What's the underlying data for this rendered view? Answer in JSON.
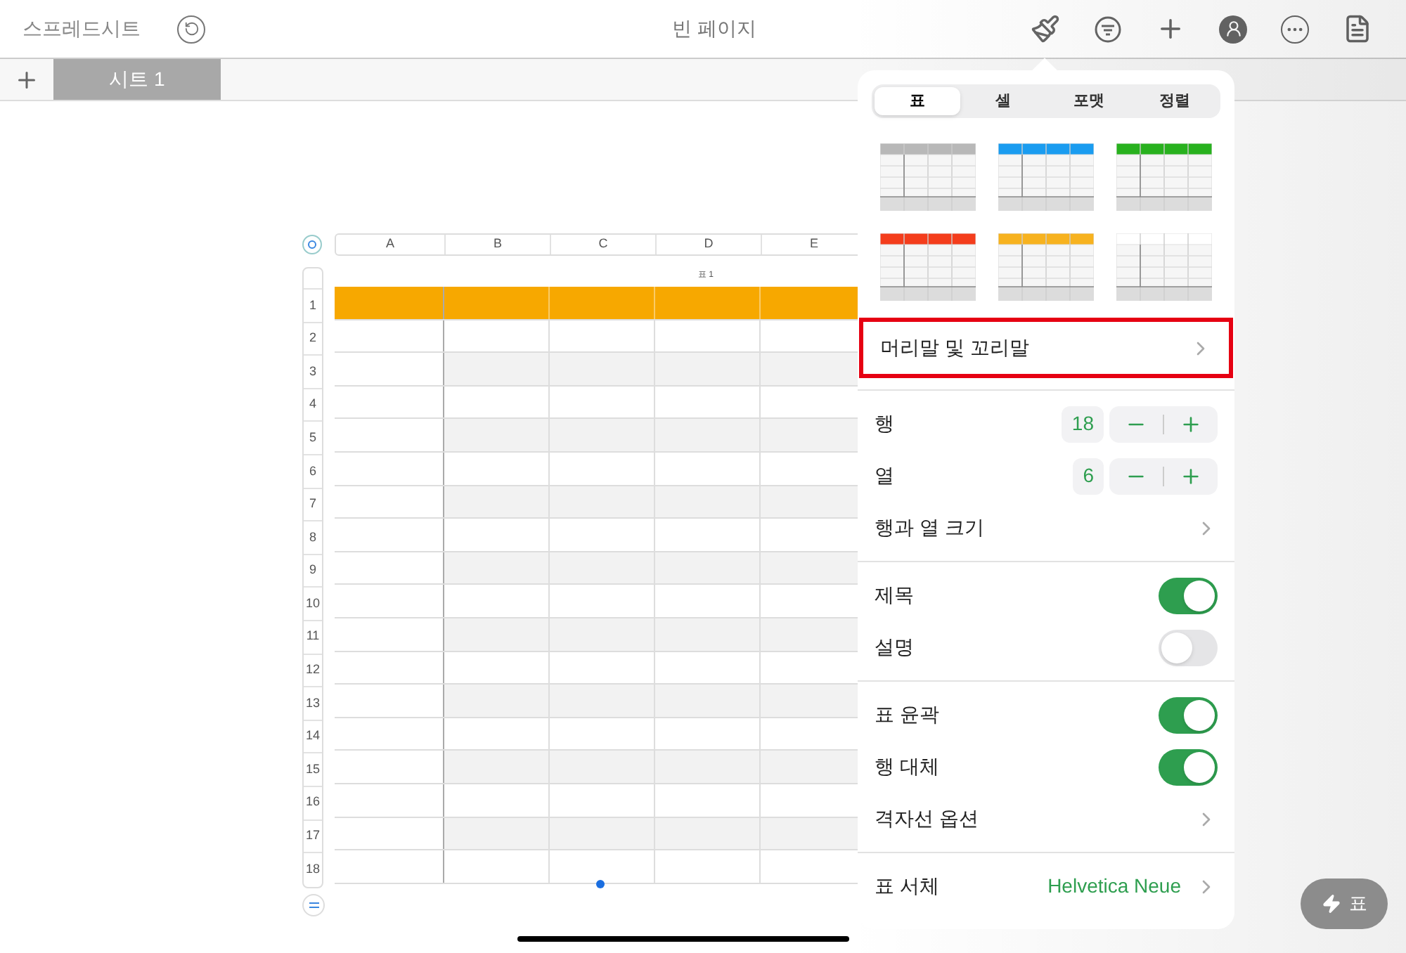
{
  "toolbar": {
    "back_label": "스프레드시트",
    "title": "빈 페이지"
  },
  "sheet_tabs": [
    {
      "label": "시트 1",
      "selected": true
    }
  ],
  "table": {
    "title": "표 1",
    "columns": [
      "A",
      "B",
      "C",
      "D",
      "E"
    ],
    "rows": [
      "1",
      "2",
      "3",
      "4",
      "5",
      "6",
      "7",
      "8",
      "9",
      "10",
      "11",
      "12",
      "13",
      "14",
      "15",
      "16",
      "17",
      "18"
    ]
  },
  "popover": {
    "tabs": [
      {
        "label": "표",
        "selected": true
      },
      {
        "label": "셀",
        "selected": false
      },
      {
        "label": "포맷",
        "selected": false
      },
      {
        "label": "정렬",
        "selected": false
      }
    ],
    "styles": [
      {
        "color": "#b8b8b8"
      },
      {
        "color": "#1a9cf0"
      },
      {
        "color": "#28b11e"
      },
      {
        "color": "#f43d1c"
      },
      {
        "color": "#f7b21f"
      },
      {
        "color": "#ffffff"
      }
    ],
    "sections": [
      [
        {
          "kind": "link",
          "label": "머리말 및 꼬리말",
          "highlighted": true
        }
      ],
      [
        {
          "kind": "stepper",
          "label": "행",
          "value": "18"
        },
        {
          "kind": "stepper",
          "label": "열",
          "value": "6"
        },
        {
          "kind": "link",
          "label": "행과 열 크기",
          "highlighted": false
        }
      ],
      [
        {
          "kind": "toggle",
          "label": "제목",
          "on": true
        },
        {
          "kind": "toggle",
          "label": "설명",
          "on": false
        }
      ],
      [
        {
          "kind": "toggle",
          "label": "표 윤곽",
          "on": true
        },
        {
          "kind": "toggle",
          "label": "행 대체",
          "on": true
        },
        {
          "kind": "link",
          "label": "격자선 옵션",
          "highlighted": false
        }
      ],
      [
        {
          "kind": "link",
          "label": "표 서체",
          "value": "Helvetica Neue",
          "highlighted": false
        }
      ]
    ]
  },
  "quick_button": {
    "label": "표"
  }
}
